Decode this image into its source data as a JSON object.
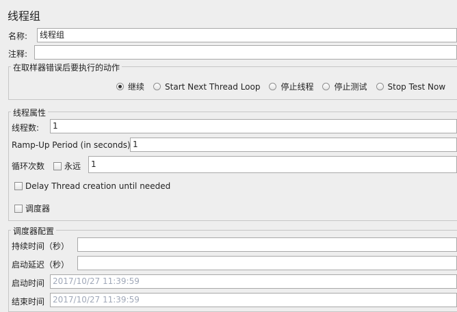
{
  "panel": {
    "title": "线程组"
  },
  "name_field": {
    "label": "名称:",
    "value": "线程组"
  },
  "comment_field": {
    "label": "注释:",
    "value": ""
  },
  "error_action": {
    "title": "在取样器错误后要执行的动作",
    "options": [
      {
        "label": "继续",
        "selected": true
      },
      {
        "label": "Start Next Thread Loop",
        "selected": false
      },
      {
        "label": "停止线程",
        "selected": false
      },
      {
        "label": "停止测试",
        "selected": false
      },
      {
        "label": "Stop Test Now",
        "selected": false
      }
    ]
  },
  "thread_props": {
    "title": "线程属性",
    "threads_label": "线程数:",
    "threads_value": "1",
    "rampup_label": "Ramp-Up Period (in seconds):",
    "rampup_value": "1",
    "loop_label": "循环次数",
    "forever_label": "永远",
    "forever_checked": false,
    "loop_value": "1",
    "delay_label": "Delay Thread creation until needed",
    "delay_checked": false,
    "scheduler_label": "调度器",
    "scheduler_checked": false
  },
  "scheduler_config": {
    "title": "调度器配置",
    "duration_label": "持续时间（秒）",
    "duration_value": "",
    "startup_delay_label": "启动延迟（秒）",
    "startup_delay_value": "",
    "start_time_label": "启动时间",
    "start_time_value": "2017/10/27 11:39:59",
    "end_time_label": "结束时间",
    "end_time_value": "2017/10/27 11:39:59"
  }
}
